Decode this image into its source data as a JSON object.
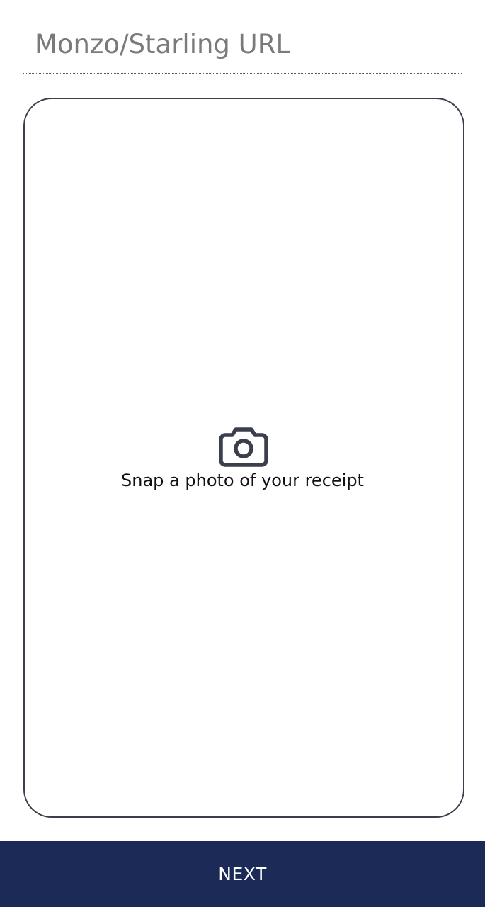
{
  "url_field": {
    "placeholder": "Monzo/Starling URL",
    "value": ""
  },
  "photo_card": {
    "icon": "camera-icon",
    "label": "Snap a photo of your receipt"
  },
  "footer": {
    "next_label": "NEXT"
  },
  "colors": {
    "accent": "#1b2a56",
    "card_border": "#3a3f4b",
    "placeholder": "#7a7a7a",
    "background": "#ffffff"
  }
}
